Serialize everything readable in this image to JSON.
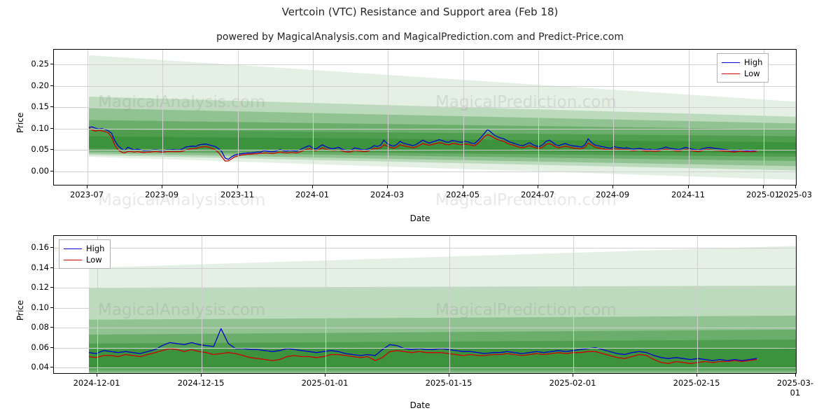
{
  "header": {
    "title": "Vertcoin (VTC) Resistance and Support area (Feb 18)",
    "subtitle": "powered by MagicalAnalysis.com and MagicalPrediction.com and Predict-Price.com"
  },
  "watermarks": {
    "left": "MagicalAnalysis.com",
    "right": "MagicalPrediction.com"
  },
  "legend": {
    "high_label": "High",
    "low_label": "Low",
    "high_color": "#0000cc",
    "low_color": "#cc0000"
  },
  "chart_data": [
    {
      "type": "line",
      "title": "Vertcoin (VTC) Resistance and Support area (Feb 18)",
      "xlabel": "Date",
      "ylabel": "Price",
      "ylim": [
        -0.035,
        0.285
      ],
      "yticks": [
        0.0,
        0.05,
        0.1,
        0.15,
        0.2,
        0.25
      ],
      "ytick_labels": [
        "0.00",
        "0.05",
        "0.10",
        "0.15",
        "0.20",
        "0.25"
      ],
      "xticks": [
        "2023-07",
        "2023-09",
        "2023-11",
        "2024-01",
        "2024-03",
        "2024-05",
        "2024-07",
        "2024-09",
        "2024-11",
        "2025-01",
        "2025-03"
      ],
      "grid": true,
      "legend_position": "upper right",
      "series": [
        {
          "name": "High",
          "color": "#0000cc",
          "values": [
            0.103,
            0.104,
            0.101,
            0.099,
            0.1,
            0.098,
            0.095,
            0.089,
            0.072,
            0.06,
            0.053,
            0.049,
            0.056,
            0.053,
            0.05,
            0.052,
            0.05,
            0.048,
            0.049,
            0.049,
            0.05,
            0.05,
            0.049,
            0.049,
            0.05,
            0.05,
            0.051,
            0.05,
            0.05,
            0.053,
            0.057,
            0.058,
            0.059,
            0.058,
            0.062,
            0.063,
            0.064,
            0.062,
            0.06,
            0.058,
            0.053,
            0.046,
            0.031,
            0.028,
            0.034,
            0.038,
            0.04,
            0.041,
            0.042,
            0.043,
            0.043,
            0.044,
            0.045,
            0.045,
            0.048,
            0.047,
            0.046,
            0.046,
            0.048,
            0.051,
            0.048,
            0.047,
            0.049,
            0.048,
            0.047,
            0.05,
            0.054,
            0.057,
            0.06,
            0.055,
            0.052,
            0.057,
            0.062,
            0.058,
            0.055,
            0.053,
            0.054,
            0.056,
            0.052,
            0.05,
            0.049,
            0.05,
            0.055,
            0.053,
            0.051,
            0.05,
            0.052,
            0.055,
            0.06,
            0.058,
            0.061,
            0.073,
            0.065,
            0.061,
            0.059,
            0.063,
            0.07,
            0.066,
            0.064,
            0.062,
            0.06,
            0.063,
            0.068,
            0.073,
            0.069,
            0.066,
            0.069,
            0.071,
            0.074,
            0.072,
            0.069,
            0.068,
            0.072,
            0.071,
            0.069,
            0.068,
            0.07,
            0.069,
            0.066,
            0.065,
            0.072,
            0.08,
            0.089,
            0.098,
            0.092,
            0.085,
            0.081,
            0.078,
            0.076,
            0.072,
            0.068,
            0.066,
            0.063,
            0.061,
            0.06,
            0.064,
            0.067,
            0.062,
            0.059,
            0.058,
            0.062,
            0.07,
            0.073,
            0.068,
            0.062,
            0.06,
            0.063,
            0.065,
            0.062,
            0.06,
            0.059,
            0.058,
            0.057,
            0.062,
            0.076,
            0.068,
            0.062,
            0.06,
            0.058,
            0.057,
            0.055,
            0.054,
            0.058,
            0.056,
            0.055,
            0.054,
            0.055,
            0.053,
            0.052,
            0.053,
            0.054,
            0.052,
            0.051,
            0.052,
            0.05,
            0.051,
            0.052,
            0.054,
            0.057,
            0.054,
            0.053,
            0.052,
            0.051,
            0.053,
            0.056,
            0.054,
            0.052,
            0.051,
            0.05,
            0.052,
            0.054,
            0.056,
            0.055,
            0.054,
            0.053,
            0.052,
            0.051,
            0.05,
            0.049,
            0.048,
            0.049,
            0.05,
            0.049,
            0.048,
            0.049,
            0.048,
            0.05
          ]
        },
        {
          "name": "Low",
          "color": "#cc0000",
          "values": [
            0.101,
            0.097,
            0.094,
            0.096,
            0.095,
            0.093,
            0.09,
            0.08,
            0.062,
            0.05,
            0.045,
            0.043,
            0.046,
            0.046,
            0.045,
            0.046,
            0.045,
            0.044,
            0.045,
            0.045,
            0.046,
            0.046,
            0.045,
            0.045,
            0.046,
            0.046,
            0.046,
            0.046,
            0.046,
            0.047,
            0.05,
            0.052,
            0.053,
            0.053,
            0.056,
            0.057,
            0.058,
            0.056,
            0.054,
            0.05,
            0.044,
            0.034,
            0.024,
            0.024,
            0.029,
            0.034,
            0.036,
            0.038,
            0.039,
            0.04,
            0.04,
            0.041,
            0.041,
            0.042,
            0.043,
            0.043,
            0.042,
            0.042,
            0.044,
            0.045,
            0.044,
            0.043,
            0.044,
            0.044,
            0.043,
            0.045,
            0.048,
            0.051,
            0.053,
            0.05,
            0.048,
            0.051,
            0.055,
            0.052,
            0.05,
            0.049,
            0.049,
            0.05,
            0.048,
            0.046,
            0.045,
            0.046,
            0.049,
            0.048,
            0.047,
            0.046,
            0.047,
            0.05,
            0.054,
            0.053,
            0.055,
            0.062,
            0.059,
            0.056,
            0.054,
            0.057,
            0.062,
            0.06,
            0.058,
            0.057,
            0.055,
            0.057,
            0.061,
            0.065,
            0.063,
            0.061,
            0.063,
            0.065,
            0.067,
            0.066,
            0.063,
            0.062,
            0.065,
            0.065,
            0.063,
            0.062,
            0.064,
            0.063,
            0.061,
            0.06,
            0.065,
            0.073,
            0.081,
            0.086,
            0.083,
            0.078,
            0.075,
            0.072,
            0.07,
            0.066,
            0.063,
            0.061,
            0.058,
            0.056,
            0.055,
            0.058,
            0.06,
            0.057,
            0.055,
            0.054,
            0.056,
            0.063,
            0.065,
            0.062,
            0.057,
            0.055,
            0.057,
            0.059,
            0.057,
            0.055,
            0.054,
            0.053,
            0.053,
            0.056,
            0.066,
            0.062,
            0.057,
            0.055,
            0.053,
            0.052,
            0.051,
            0.05,
            0.053,
            0.052,
            0.051,
            0.05,
            0.051,
            0.049,
            0.048,
            0.049,
            0.05,
            0.048,
            0.047,
            0.048,
            0.047,
            0.047,
            0.048,
            0.05,
            0.052,
            0.05,
            0.049,
            0.048,
            0.047,
            0.049,
            0.051,
            0.05,
            0.048,
            0.047,
            0.046,
            0.048,
            0.05,
            0.051,
            0.05,
            0.049,
            0.049,
            0.048,
            0.047,
            0.047,
            0.046,
            0.045,
            0.046,
            0.047,
            0.046,
            0.046,
            0.046,
            0.046,
            0.047
          ]
        }
      ]
    },
    {
      "type": "line",
      "title": "",
      "xlabel": "Date",
      "ylabel": "Price",
      "ylim": [
        0.033,
        0.172
      ],
      "yticks": [
        0.04,
        0.06,
        0.08,
        0.1,
        0.12,
        0.14,
        0.16
      ],
      "ytick_labels": [
        "0.04",
        "0.06",
        "0.08",
        "0.10",
        "0.12",
        "0.14",
        "0.16"
      ],
      "xticks": [
        "2024-12-01",
        "2024-12-15",
        "2025-01-01",
        "2025-01-15",
        "2025-02-01",
        "2025-02-15",
        "2025-03-01"
      ],
      "grid": true,
      "legend_position": "upper left",
      "series": [
        {
          "name": "High",
          "color": "#0000cc",
          "values": [
            0.055,
            0.054,
            0.057,
            0.056,
            0.055,
            0.056,
            0.055,
            0.054,
            0.056,
            0.058,
            0.062,
            0.065,
            0.064,
            0.063,
            0.065,
            0.063,
            0.062,
            0.061,
            0.079,
            0.064,
            0.059,
            0.059,
            0.058,
            0.058,
            0.057,
            0.056,
            0.057,
            0.059,
            0.058,
            0.057,
            0.056,
            0.055,
            0.056,
            0.057,
            0.056,
            0.054,
            0.053,
            0.052,
            0.053,
            0.052,
            0.058,
            0.063,
            0.062,
            0.059,
            0.058,
            0.059,
            0.058,
            0.058,
            0.059,
            0.058,
            0.057,
            0.056,
            0.056,
            0.055,
            0.054,
            0.055,
            0.055,
            0.056,
            0.055,
            0.054,
            0.055,
            0.056,
            0.055,
            0.056,
            0.057,
            0.056,
            0.057,
            0.058,
            0.059,
            0.06,
            0.058,
            0.056,
            0.054,
            0.053,
            0.055,
            0.056,
            0.055,
            0.052,
            0.05,
            0.049,
            0.05,
            0.049,
            0.048,
            0.049,
            0.048,
            0.047,
            0.048,
            0.047,
            0.048,
            0.047,
            0.048,
            0.049
          ]
        },
        {
          "name": "Low",
          "color": "#cc0000",
          "values": [
            0.051,
            0.05,
            0.052,
            0.052,
            0.051,
            0.053,
            0.052,
            0.051,
            0.053,
            0.055,
            0.057,
            0.059,
            0.058,
            0.056,
            0.058,
            0.056,
            0.055,
            0.053,
            0.054,
            0.055,
            0.054,
            0.052,
            0.05,
            0.049,
            0.048,
            0.047,
            0.048,
            0.051,
            0.052,
            0.051,
            0.051,
            0.05,
            0.051,
            0.053,
            0.053,
            0.052,
            0.051,
            0.05,
            0.051,
            0.047,
            0.05,
            0.056,
            0.057,
            0.056,
            0.055,
            0.056,
            0.055,
            0.055,
            0.055,
            0.054,
            0.053,
            0.052,
            0.053,
            0.052,
            0.052,
            0.053,
            0.053,
            0.054,
            0.053,
            0.052,
            0.053,
            0.054,
            0.053,
            0.054,
            0.055,
            0.054,
            0.055,
            0.055,
            0.056,
            0.056,
            0.054,
            0.052,
            0.05,
            0.049,
            0.051,
            0.053,
            0.052,
            0.048,
            0.045,
            0.044,
            0.046,
            0.045,
            0.044,
            0.045,
            0.046,
            0.045,
            0.046,
            0.046,
            0.047,
            0.046,
            0.047,
            0.048
          ]
        }
      ]
    }
  ]
}
